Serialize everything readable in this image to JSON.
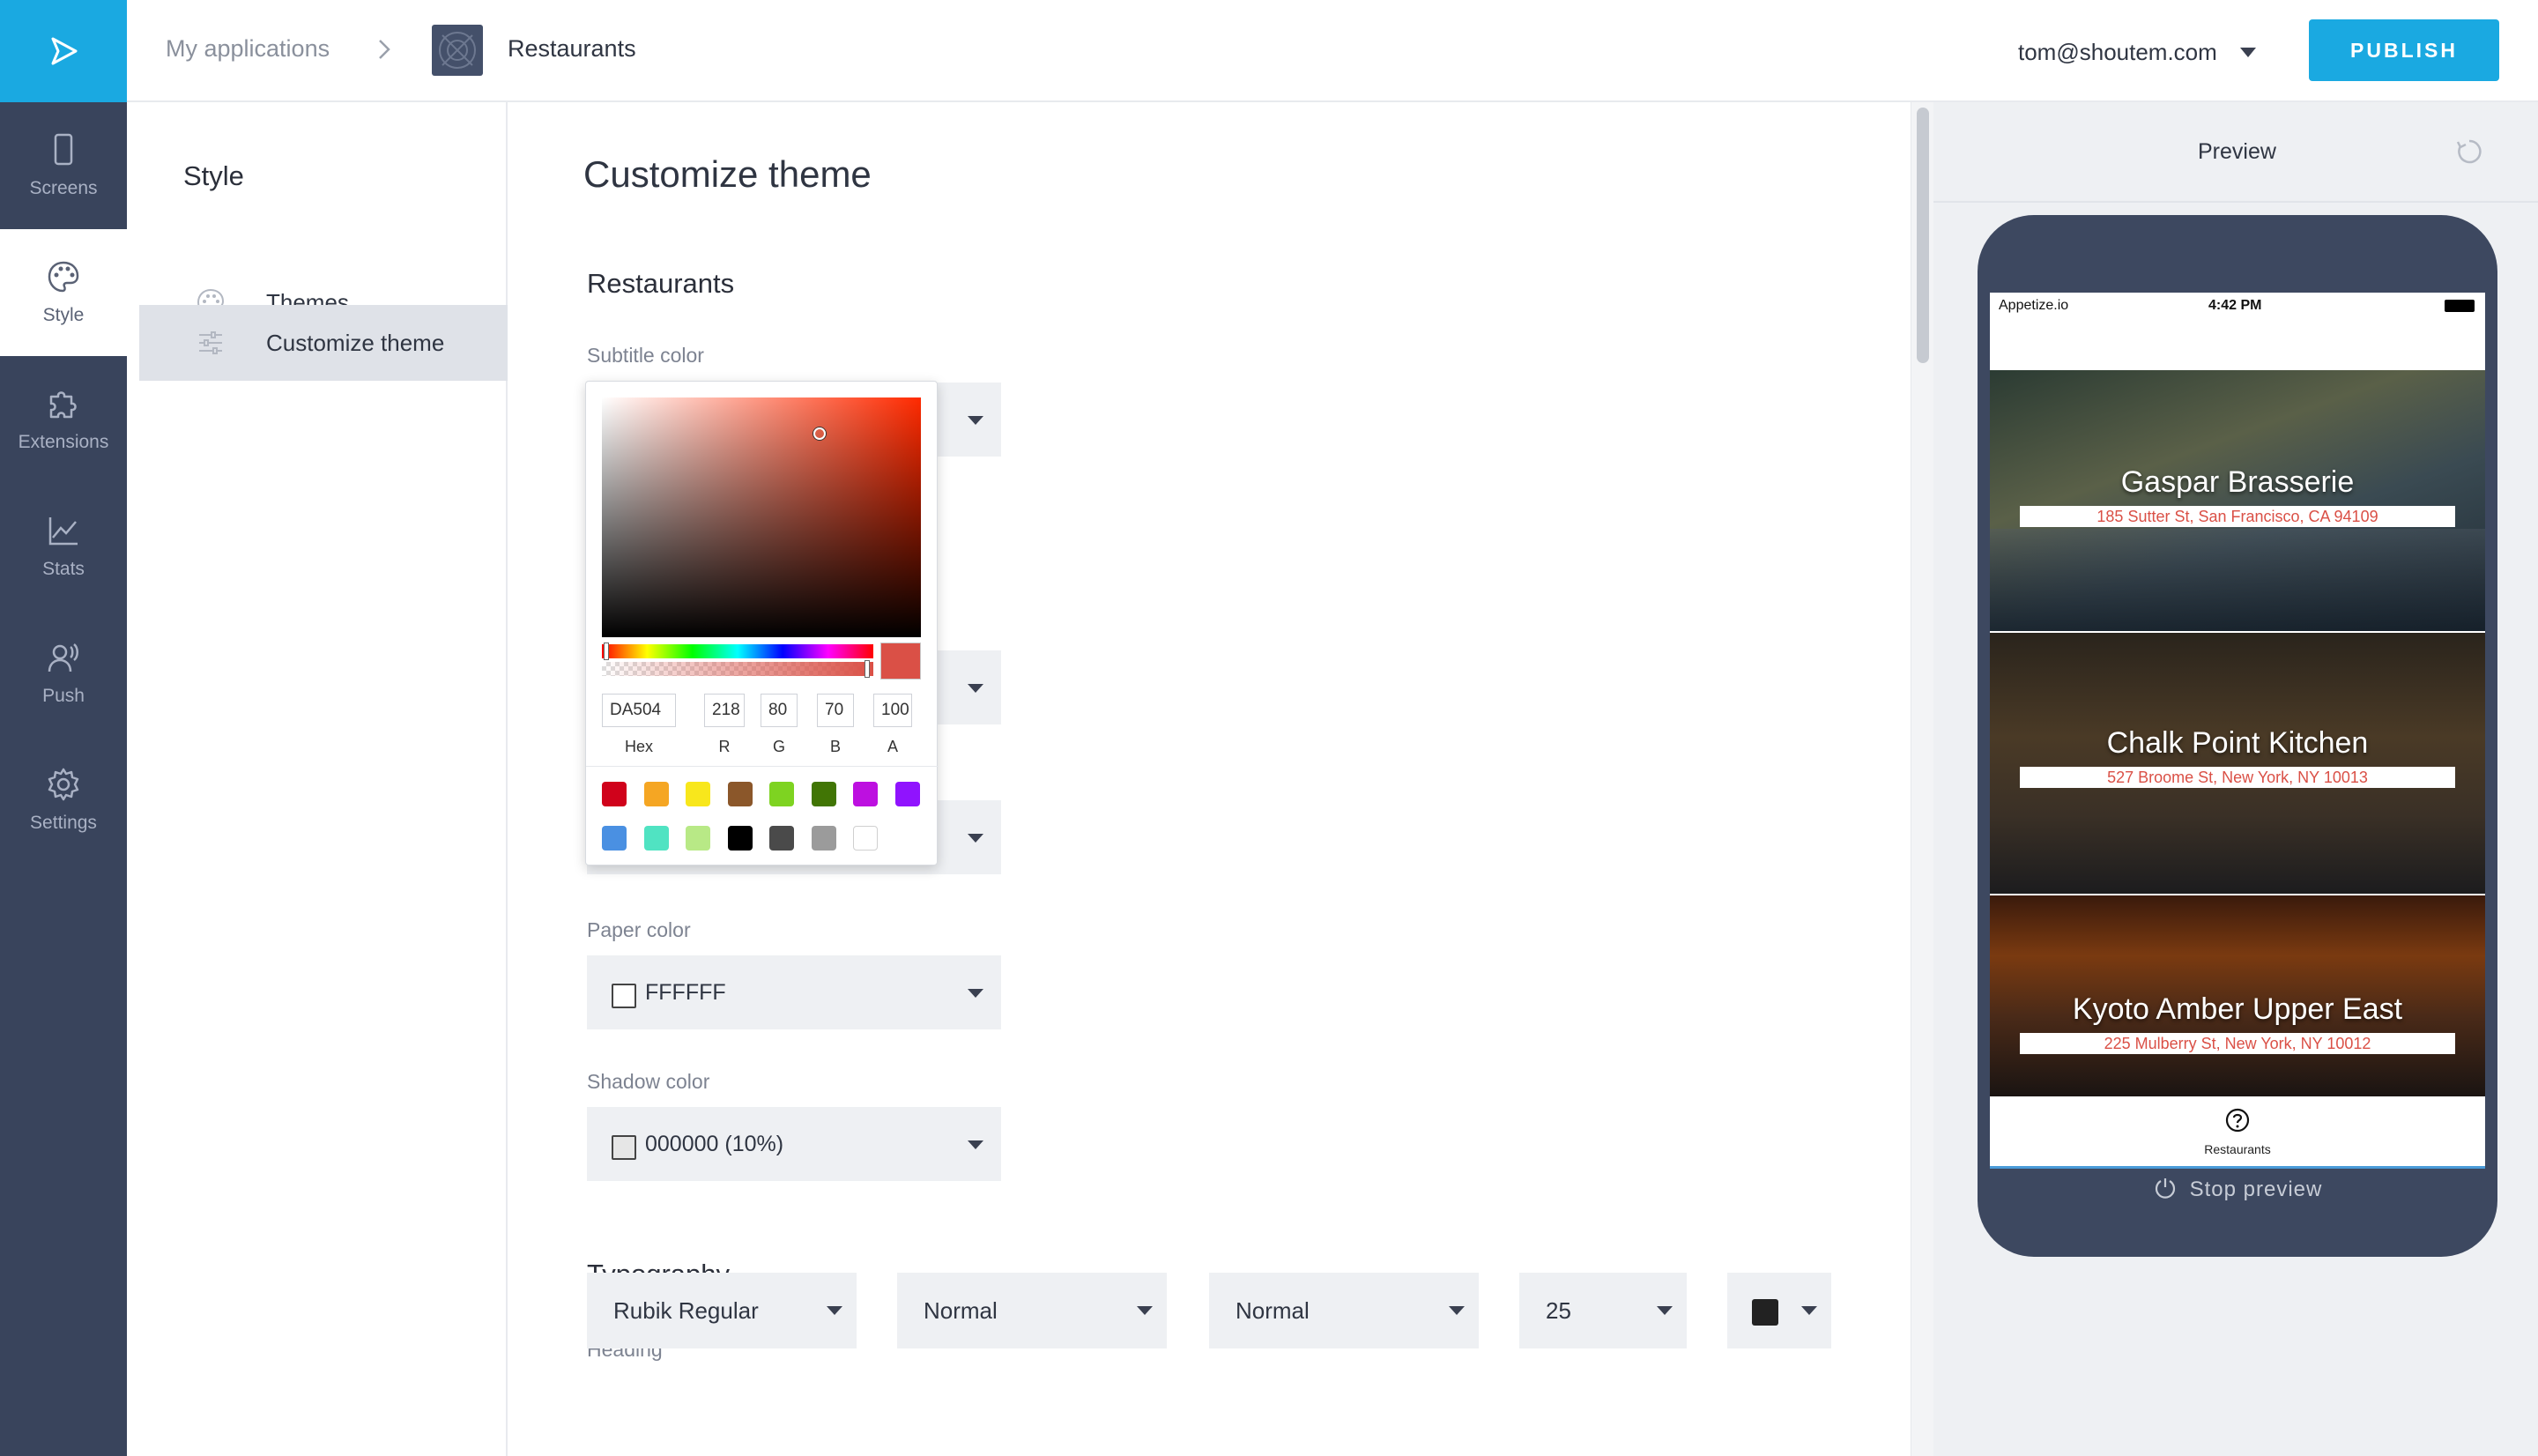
{
  "nav": {
    "items": [
      {
        "label": "Screens",
        "icon": "phone-icon"
      },
      {
        "label": "Style",
        "icon": "palette-icon"
      },
      {
        "label": "Extensions",
        "icon": "puzzle-icon"
      },
      {
        "label": "Stats",
        "icon": "chart-icon"
      },
      {
        "label": "Push",
        "icon": "push-icon"
      },
      {
        "label": "Settings",
        "icon": "gear-icon"
      }
    ],
    "active": "Style"
  },
  "header": {
    "breadcrumb_root": "My applications",
    "app_name": "Restaurants",
    "user_email": "tom@shoutem.com",
    "publish_label": "PUBLISH"
  },
  "subnav": {
    "title": "Style",
    "items": [
      {
        "label": "Themes"
      },
      {
        "label": "Customize theme"
      }
    ]
  },
  "main": {
    "title": "Customize theme",
    "section": "Restaurants",
    "fields": {
      "subtitle_label": "Subtitle color",
      "paper_label": "Paper color",
      "paper_value": "FFFFFF",
      "shadow_label": "Shadow color",
      "shadow_value": "000000 (10%)"
    },
    "typography": {
      "title": "Typography",
      "heading_label": "Heading",
      "font": "Rubik Regular",
      "weight": "Normal",
      "style": "Normal",
      "size": "25"
    }
  },
  "picker": {
    "hex": "DA504",
    "r": "218",
    "g": "80",
    "b": "70",
    "a": "100",
    "labels": {
      "hex": "Hex",
      "r": "R",
      "g": "G",
      "b": "B",
      "a": "A"
    },
    "current_color": "#da5046",
    "swatches": [
      "#d0021b",
      "#f5a623",
      "#f8e71c",
      "#8b572a",
      "#7ed321",
      "#417505",
      "#bd10e0",
      "#9013fe",
      "#4a90e2",
      "#50e3c2",
      "#b8e986",
      "#000000",
      "#4a4a4a",
      "#9b9b9b",
      "#ffffff"
    ]
  },
  "preview": {
    "title": "Preview",
    "status": {
      "carrier": "Appetize.io",
      "time": "4:42 PM"
    },
    "cards": [
      {
        "name": "Gaspar Brasserie",
        "address": "185 Sutter St, San Francisco, CA 94109"
      },
      {
        "name": "Chalk Point Kitchen",
        "address": "527 Broome St, New York, NY 10013"
      },
      {
        "name": "Kyoto Amber Upper East",
        "address": "225 Mulberry St, New York, NY 10012"
      }
    ],
    "tab_label": "Restaurants",
    "stop_label": "Stop preview"
  },
  "colors": {
    "accent": "#1aa9e1",
    "rail": "#39445c",
    "phone": "#3d4860",
    "address": "#da5046"
  }
}
